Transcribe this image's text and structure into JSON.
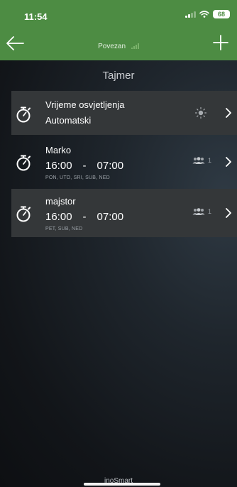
{
  "status_bar": {
    "time": "11:54",
    "battery": "68"
  },
  "header": {
    "connection_label": "Povezan",
    "background_color": "#4d8c43"
  },
  "page": {
    "title": "Tajmer"
  },
  "lighting_row": {
    "title": "Vrijeme osvjetljenja",
    "mode": "Automatski",
    "icon": "sun-icon"
  },
  "timers": [
    {
      "name": "Marko",
      "start": "16:00",
      "separator": "-",
      "end": "07:00",
      "days": "PON, UTO, SRI, SUB, NED",
      "users_count": "1",
      "highlighted": false
    },
    {
      "name": "majstor",
      "start": "16:00",
      "separator": "-",
      "end": "07:00",
      "days": "PET, SUB, NED",
      "users_count": "1",
      "highlighted": true
    }
  ],
  "footer": {
    "brand": "inoSmart"
  }
}
